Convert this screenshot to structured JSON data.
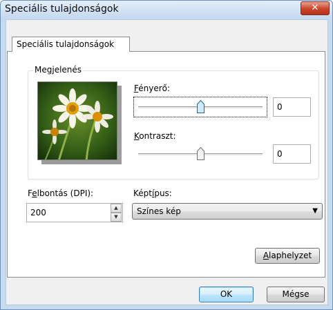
{
  "window": {
    "title": "Speciális tulajdonságok",
    "close_glyph": "✕"
  },
  "tab": {
    "label": "Speciális tulajdonságok"
  },
  "appearance": {
    "group_label": "Megjelenés",
    "brightness": {
      "label": "Fényerő:",
      "accesskey": "F",
      "rest": "ényerő:",
      "value": "0",
      "position_fraction": 0.5
    },
    "contrast": {
      "label": "Kontraszt:",
      "accesskey": "K",
      "rest": "ontraszt:",
      "value": "0",
      "position_fraction": 0.5
    },
    "preview_icon": "flower-photo"
  },
  "resolution": {
    "label_pre": "F",
    "label_key": "e",
    "label_post": "lbontás (DPI):",
    "value": "200"
  },
  "image_type": {
    "label_pre": "Képt",
    "label_key": "í",
    "label_post": "pus:",
    "selected": "Színes kép"
  },
  "buttons": {
    "reset_key": "A",
    "reset_rest": "laphelyzet",
    "ok": "OK",
    "cancel": "Mégse"
  },
  "colors": {
    "accent": "#3c7fb1",
    "close_button": "#c8452b",
    "title_bar": "#c4d8ef"
  }
}
